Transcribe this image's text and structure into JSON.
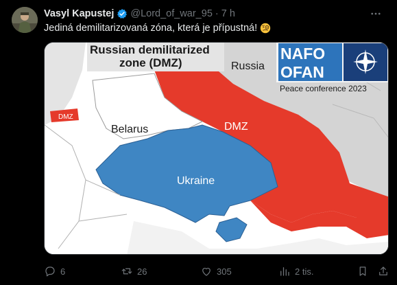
{
  "tweet": {
    "author_name": "Vasyl Kapustej",
    "handle": "@Lord_of_war_95",
    "separator": "·",
    "time": "7 h",
    "text": "Jediná demilitarizovaná zóna, která je přípustná!",
    "emoji": "face-with-monocle"
  },
  "image": {
    "title_line1": "Russian demilitarized",
    "title_line2": "zone (DMZ)",
    "label_russia": "Russia",
    "label_belarus": "Belarus",
    "label_ukraine": "Ukraine",
    "label_dmz": "DMZ",
    "label_dmz_small": "DMZ",
    "logo_top": "NAFO",
    "logo_bottom": "OFAN",
    "logo_caption": "Peace conference 2023",
    "colors": {
      "dmz_red": "#e53a2b",
      "ukraine_blue": "#3f86c3",
      "russia_gray": "#d4d4d4",
      "land_white": "#ffffff",
      "nato_navy": "#1a3f7a"
    }
  },
  "actions": {
    "replies": "6",
    "reposts": "26",
    "likes": "305",
    "views": "2 tis."
  }
}
